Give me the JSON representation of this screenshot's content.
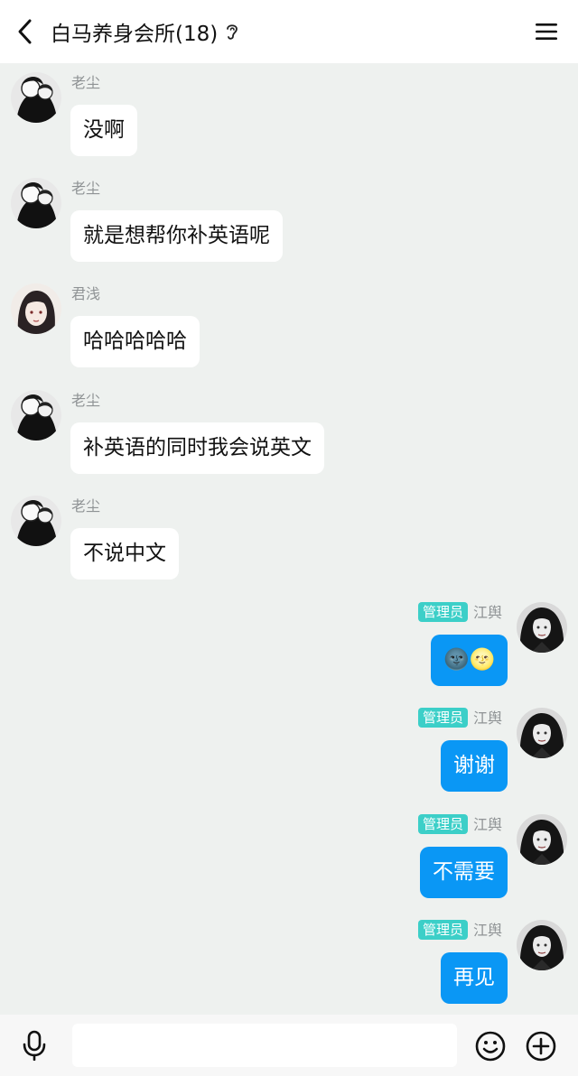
{
  "header": {
    "title": "白马养身会所(18)",
    "back_icon": "chevron-left-icon",
    "ear_icon": "ear-icon",
    "menu_icon": "hamburger-menu-icon"
  },
  "messages": [
    {
      "sender": "老尘",
      "text": "没啊",
      "direction": "in",
      "avatar": "manga-couple-avatar"
    },
    {
      "sender": "老尘",
      "text": "就是想帮你补英语呢",
      "direction": "in",
      "avatar": "manga-couple-avatar"
    },
    {
      "sender": "君浅",
      "text": "哈哈哈哈哈",
      "direction": "in",
      "avatar": "anime-boy-avatar"
    },
    {
      "sender": "老尘",
      "text": "补英语的同时我会说英文",
      "direction": "in",
      "avatar": "manga-couple-avatar"
    },
    {
      "sender": "老尘",
      "text": "不说中文",
      "direction": "in",
      "avatar": "manga-couple-avatar"
    },
    {
      "sender": "江舆",
      "badge": "管理员",
      "text": "🌚🌝",
      "direction": "out",
      "avatar": "dark-hair-girl-avatar"
    },
    {
      "sender": "江舆",
      "badge": "管理员",
      "text": "谢谢",
      "direction": "out",
      "avatar": "dark-hair-girl-avatar"
    },
    {
      "sender": "江舆",
      "badge": "管理员",
      "text": "不需要",
      "direction": "out",
      "avatar": "dark-hair-girl-avatar"
    },
    {
      "sender": "江舆",
      "badge": "管理员",
      "text": "再见",
      "direction": "out",
      "avatar": "dark-hair-girl-avatar"
    }
  ],
  "input_bar": {
    "text_value": "",
    "placeholder": "",
    "mic_icon": "microphone-icon",
    "emoji_icon": "smiley-face-icon",
    "plus_icon": "plus-circle-icon"
  },
  "colors": {
    "background": "#eef1ef",
    "outgoing_bubble": "#0a97f5",
    "incoming_bubble": "#ffffff",
    "admin_badge": "#3ccfc8"
  }
}
